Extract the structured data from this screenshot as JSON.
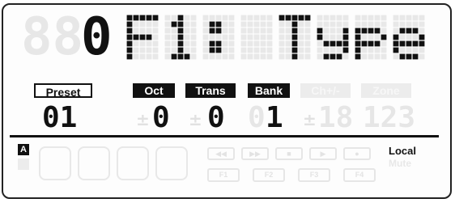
{
  "display": {
    "ghost_digits": "88",
    "patch_digit": "0",
    "message": "F1: Type"
  },
  "labels": {
    "preset": "Preset",
    "oct": "Oct",
    "trans": "Trans",
    "bank": "Bank",
    "ch": "Ch+/-",
    "zone": "Zone"
  },
  "values": {
    "preset": "01",
    "oct": "0",
    "trans": "0",
    "bank": "1",
    "ch_dim": "18",
    "zone_dim": "123",
    "plus_minus": "±"
  },
  "indicators": {
    "mode_a": "A",
    "local": "Local",
    "mute": "Mute"
  },
  "transport": {
    "buttons": [
      "◀◀",
      "▶▶",
      "■",
      "▶",
      "●"
    ],
    "function_buttons": [
      "F1",
      "F2",
      "F3",
      "F4"
    ]
  },
  "colors": {
    "ink": "#111111",
    "unlit": "#e8e8e8",
    "background": "#fdfdfd"
  }
}
